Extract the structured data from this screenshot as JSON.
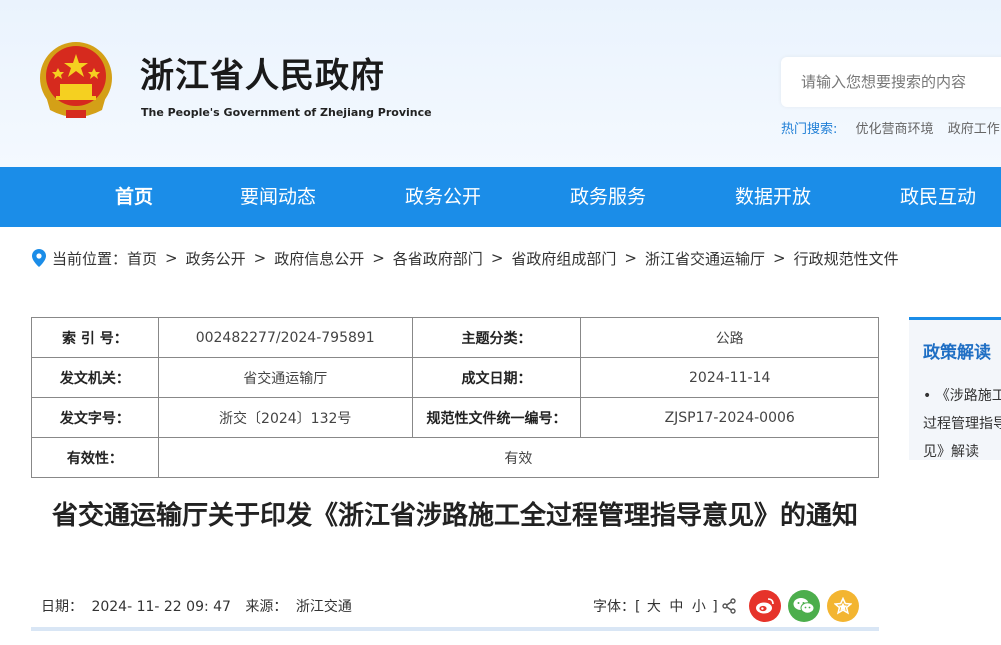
{
  "header": {
    "site_title": "浙江省人民政府",
    "site_subtitle": "The People's Government of Zhejiang Province",
    "emblem_icon": "national-emblem-icon",
    "search": {
      "placeholder": "请输入您想要搜索的内容",
      "value": ""
    },
    "hot_search": {
      "label": "热门搜索:",
      "items": [
        "优化营商环境",
        "政府工作"
      ]
    }
  },
  "nav": {
    "items": [
      {
        "label": "首页",
        "active": true
      },
      {
        "label": "要闻动态"
      },
      {
        "label": "政务公开"
      },
      {
        "label": "政务服务"
      },
      {
        "label": "数据开放"
      },
      {
        "label": "政民互动"
      }
    ],
    "color": "#1b8de8"
  },
  "breadcrumb": {
    "prefix": "当前位置：",
    "items": [
      "首页",
      "政务公开",
      "政府信息公开",
      "各省政府部门",
      "省政府组成部门",
      "浙江省交通运输厅",
      "行政规范性文件"
    ],
    "separator": ">"
  },
  "meta": {
    "index_label": "索 引 号：",
    "index_value": "002482277/2024-795891",
    "topic_label": "主题分类：",
    "topic_value": "公路",
    "issuer_label": "发文机关：",
    "issuer_value": "省交通运输厅",
    "date_label": "成文日期：",
    "date_value": "2024-11-14",
    "docno_label": "发文字号：",
    "docno_value": "浙交〔2024〕132号",
    "code_label": "规范性文件统一编号：",
    "code_value": "ZJSP17-2024-0006",
    "validity_label": "有效性：",
    "validity_value": "有效"
  },
  "article": {
    "title": "省交通运输厅关于印发《浙江省涉路施工全过程管理指导意见》的通知",
    "date_label": "日期：",
    "date_value": "2024- 11- 22 09: 47",
    "source_label": "来源：",
    "source_value": "浙江交通",
    "font_label": "字体：[",
    "font_options": [
      "大",
      "中",
      "小"
    ],
    "font_close": "]"
  },
  "share": {
    "icons": [
      "share-icon",
      "weibo-icon",
      "wechat-icon",
      "favorite-icon"
    ],
    "colors": {
      "weibo": "#e6332a",
      "wechat": "#4cae4c",
      "favorite": "#f3b531"
    }
  },
  "sidebar": {
    "title": "政策解读",
    "item": "《涉路施工全过程管理指导意见》解读"
  }
}
